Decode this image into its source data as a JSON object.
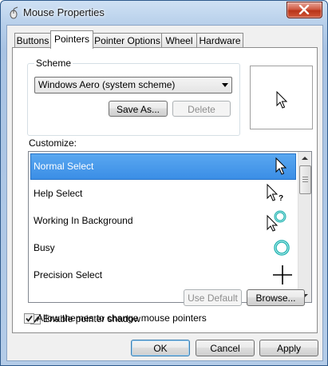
{
  "window": {
    "title": "Mouse Properties"
  },
  "tabs": [
    {
      "label": "Buttons"
    },
    {
      "label": "Pointers",
      "active": true
    },
    {
      "label": "Pointer Options"
    },
    {
      "label": "Wheel"
    },
    {
      "label": "Hardware"
    }
  ],
  "scheme": {
    "label": "Scheme",
    "selected": "Windows Aero (system scheme)",
    "save_as_label": "Save As...",
    "delete_label": "Delete"
  },
  "customize": {
    "label": "Customize:",
    "items": [
      {
        "label": "Normal Select",
        "icon": "arrow-pointer-icon",
        "selected": true
      },
      {
        "label": "Help Select",
        "icon": "help-pointer-icon"
      },
      {
        "label": "Working In Background",
        "icon": "working-pointer-icon"
      },
      {
        "label": "Busy",
        "icon": "busy-ring-icon"
      },
      {
        "label": "Precision Select",
        "icon": "crosshair-icon"
      }
    ]
  },
  "options": {
    "enable_shadow_label": "Enable pointer shadow",
    "enable_shadow_checked": true,
    "use_default_label": "Use Default",
    "browse_label": "Browse...",
    "allow_themes_label": "Allow themes to change mouse pointers",
    "allow_themes_checked": true
  },
  "footer": {
    "ok_label": "OK",
    "cancel_label": "Cancel",
    "apply_label": "Apply"
  },
  "colors": {
    "selection": "#3b8ee6",
    "busy_ring": "#1fb1b0",
    "close_button": "#c8462b"
  }
}
